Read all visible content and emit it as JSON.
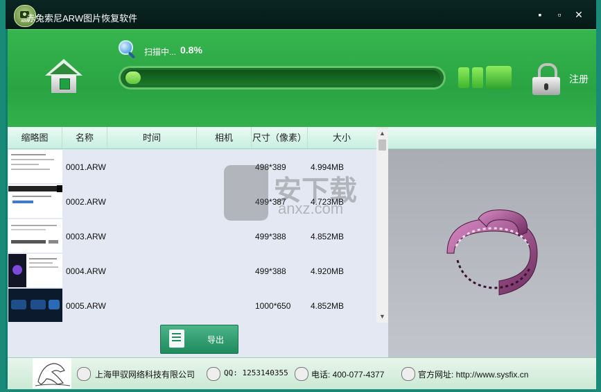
{
  "window": {
    "title": "赤兔索尼ARW图片恢复软件",
    "app_icon": "camera-logo-icon",
    "controls": {
      "minimize": "▪",
      "maximize": "▫",
      "close": "✕"
    }
  },
  "header": {
    "home_icon": "home-icon",
    "scan": {
      "label": "扫描中...",
      "percent_text": "0.8%",
      "progress": 0.008
    },
    "register_label": "注册",
    "colors": {
      "header_green": "#2aa443",
      "progress_fill": "#8fe35a"
    }
  },
  "table": {
    "columns": [
      "缩略图",
      "名称",
      "时间",
      "相机",
      "尺寸（像素）",
      "大小"
    ],
    "rows": [
      {
        "name": "0001.ARW",
        "time": "",
        "camera": "",
        "size_px": "498*389",
        "size": "4.994MB"
      },
      {
        "name": "0002.ARW",
        "time": "",
        "camera": "",
        "size_px": "499*387",
        "size": "4.723MB"
      },
      {
        "name": "0003.ARW",
        "time": "",
        "camera": "",
        "size_px": "499*388",
        "size": "4.852MB"
      },
      {
        "name": "0004.ARW",
        "time": "",
        "camera": "",
        "size_px": "499*388",
        "size": "4.920MB"
      },
      {
        "name": "0005.ARW",
        "time": "",
        "camera": "",
        "size_px": "1000*650",
        "size": "4.852MB"
      }
    ]
  },
  "export_label": "导出",
  "watermark": {
    "text_cn": "安下载",
    "text_en": "anxz.com"
  },
  "footer": {
    "company": "上海甲驭网络科技有限公司",
    "qq": "QQ: 1253140355",
    "phone": "电话: 400-077-4377",
    "website": "官方网址: http://www.sysfix.cn"
  }
}
